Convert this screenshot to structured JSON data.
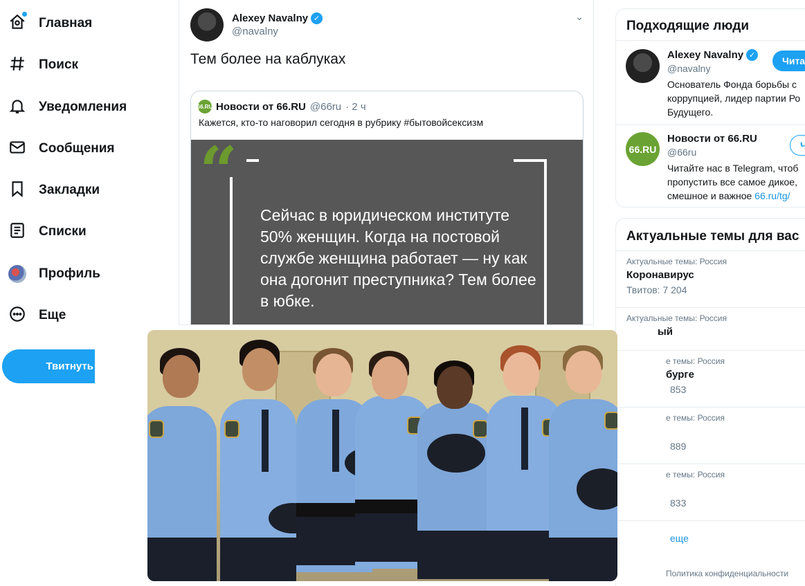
{
  "nav": {
    "items": [
      {
        "label": "Главная",
        "icon": "home-icon"
      },
      {
        "label": "Поиск",
        "icon": "hashtag-icon"
      },
      {
        "label": "Уведомления",
        "icon": "bell-icon"
      },
      {
        "label": "Сообщения",
        "icon": "mail-icon"
      },
      {
        "label": "Закладки",
        "icon": "bookmark-icon"
      },
      {
        "label": "Списки",
        "icon": "list-icon"
      },
      {
        "label": "Профиль",
        "icon": "avatar"
      },
      {
        "label": "Еще",
        "icon": "more-icon"
      }
    ],
    "tweet_button": "Твитнуть"
  },
  "tweet": {
    "author_name": "Alexey Navalny",
    "author_handle": "@navalny",
    "text": "Тем более на каблуках",
    "quote": {
      "author_name": "Новости от 66.RU",
      "author_handle": "@66ru",
      "time": "· 2 ч",
      "logo_text": "66.RU",
      "text": "Кажется, кто-то наговорил сегодня в рубрику #бытовойсексизм",
      "image_quote": "Сейчас в юридическом институте 50% женщин. Когда на постовой службе женщина работает — ну как она догонит преступника? Тем более в юбке."
    }
  },
  "who_to_follow": {
    "title": "Подходящие люди",
    "people": [
      {
        "name": "Alexey Navalny",
        "handle": "@navalny",
        "bio": "Основатель Фонда борьбы с коррупцией, лидер партии Ро Будущего.",
        "button": "Чита"
      },
      {
        "name": "Новости от 66.RU",
        "handle": "@66ru",
        "bio": "Читайте нас в Telegram, чтоб пропустить все самое дикое, смешное и важное",
        "link": "66.ru/tg/",
        "button": "Ч"
      }
    ]
  },
  "trends": {
    "title": "Актуальные темы для вас",
    "items": [
      {
        "context": "Актуальные темы: Россия",
        "name": "Коронавирус",
        "count": "Твитов: 7 204"
      },
      {
        "context": "Актуальные темы: Россия",
        "name": "ый",
        "count": ""
      },
      {
        "context": "е темы: Россия",
        "name": "бурге",
        "count": "853"
      },
      {
        "context": "е темы: Россия",
        "name": "",
        "count": "889"
      },
      {
        "context": "е темы: Россия",
        "name": "",
        "count": "833"
      }
    ],
    "show_more": "еще"
  },
  "footer": {
    "privacy": "Политика конфиденциальности"
  },
  "colors": {
    "accent": "#1da1f2",
    "brand_green": "#6aa333",
    "quote_bg": "#575757"
  }
}
